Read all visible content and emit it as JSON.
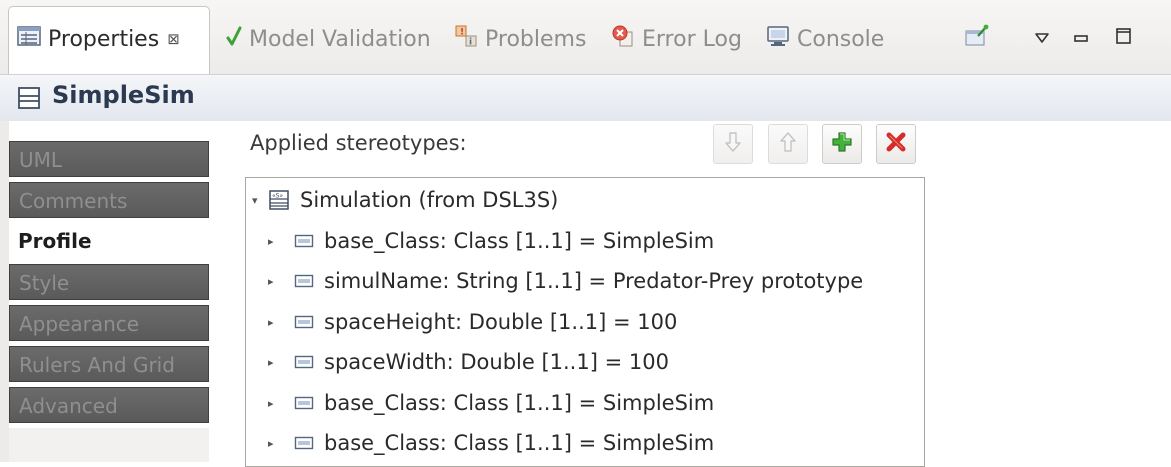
{
  "tabs": [
    {
      "label": "Properties",
      "icon": "properties-icon",
      "active": true
    },
    {
      "label": "Model Validation",
      "icon": "checkmark-icon",
      "active": false
    },
    {
      "label": "Problems",
      "icon": "problems-icon",
      "active": false
    },
    {
      "label": "Error Log",
      "icon": "error-log-icon",
      "active": false
    },
    {
      "label": "Console",
      "icon": "console-icon",
      "active": false
    }
  ],
  "tab_close_glyph": "⊠",
  "header": {
    "title": "SimpleSim"
  },
  "sidebar": {
    "items": [
      {
        "label": "UML",
        "active": false
      },
      {
        "label": "Comments",
        "active": false
      },
      {
        "label": "Profile",
        "active": true
      },
      {
        "label": "Style",
        "active": false
      },
      {
        "label": "Appearance",
        "active": false
      },
      {
        "label": "Rulers And Grid",
        "active": false
      },
      {
        "label": "Advanced",
        "active": false
      }
    ]
  },
  "main": {
    "applied_label": "Applied stereotypes:",
    "buttons": [
      {
        "name": "move-down",
        "enabled": false
      },
      {
        "name": "move-up",
        "enabled": false
      },
      {
        "name": "add",
        "enabled": true
      },
      {
        "name": "remove",
        "enabled": true
      }
    ],
    "tree": {
      "root": {
        "label": "Simulation   (from DSL3S)",
        "expanded": true
      },
      "children": [
        {
          "label": "base_Class: Class [1..1] = SimpleSim"
        },
        {
          "label": "simulName: String [1..1] = Predator-Prey prototype"
        },
        {
          "label": "spaceHeight: Double [1..1] = 100"
        },
        {
          "label": "spaceWidth: Double [1..1] = 100"
        },
        {
          "label": "base_Class: Class [1..1] = SimpleSim"
        },
        {
          "label": "base_Class: Class [1..1] = SimpleSim"
        }
      ]
    }
  },
  "colors": {
    "sidebar_inactive_bg": "#626262",
    "sidebar_inactive_text": "#8f8f8f",
    "add_green": "#3aa335",
    "remove_red": "#d62b2b"
  }
}
